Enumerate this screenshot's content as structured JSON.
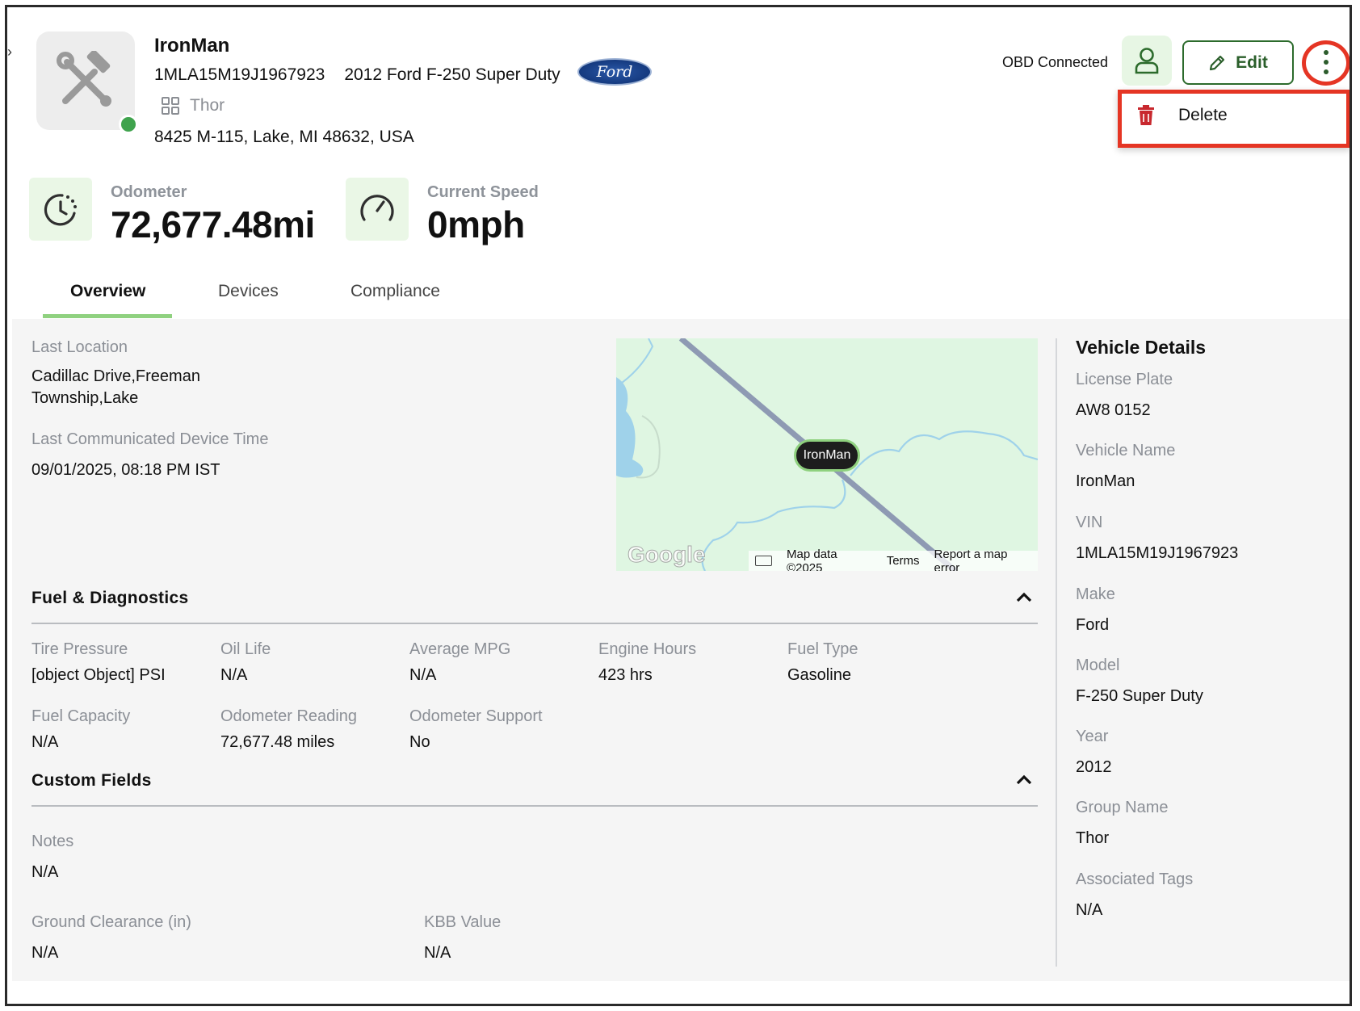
{
  "header": {
    "vehicle_name": "IronMan",
    "vin": "1MLA15M19J1967923",
    "description": "2012 Ford F-250 Super Duty",
    "make_logo": "Ford",
    "group": "Thor",
    "address": "8425 M-115, Lake, MI 48632, USA",
    "status_color": "#3fa34d"
  },
  "actions": {
    "obd_status": "OBD Connected",
    "edit_label": "Edit",
    "menu": {
      "delete_label": "Delete"
    }
  },
  "stats": {
    "odometer_label": "Odometer",
    "odometer_value": "72,677.48mi",
    "speed_label": "Current Speed",
    "speed_value": "0mph"
  },
  "tabs": [
    {
      "label": "Overview",
      "active": true
    },
    {
      "label": "Devices",
      "active": false
    },
    {
      "label": "Compliance",
      "active": false
    }
  ],
  "location": {
    "last_location_label": "Last Location",
    "last_location_line1": "Cadillac Drive,Freeman",
    "last_location_line2": "Township,Lake",
    "last_comm_label": "Last Communicated Device Time",
    "last_comm_value": "09/01/2025, 08:18 PM IST"
  },
  "map": {
    "pin_label": "IronMan",
    "google_logo": "Google",
    "map_data": "Map data ©2025",
    "terms": "Terms",
    "report": "Report a map error"
  },
  "fuel": {
    "title": "Fuel & Diagnostics",
    "fields": [
      {
        "label": "Tire Pressure",
        "value": "[object Object] PSI"
      },
      {
        "label": "Oil Life",
        "value": "N/A"
      },
      {
        "label": "Average MPG",
        "value": "N/A"
      },
      {
        "label": "Engine Hours",
        "value": "423 hrs"
      },
      {
        "label": "Fuel Type",
        "value": "Gasoline"
      },
      {
        "label": "Fuel Capacity",
        "value": "N/A"
      },
      {
        "label": "Odometer Reading",
        "value": "72,677.48 miles"
      },
      {
        "label": "Odometer Support",
        "value": "No"
      }
    ]
  },
  "custom": {
    "title": "Custom Fields",
    "fields": [
      {
        "label": "Notes",
        "value": "N/A"
      },
      {
        "label": "Ground Clearance (in)",
        "value": "N/A"
      },
      {
        "label": "KBB Value",
        "value": "N/A"
      }
    ]
  },
  "vehicle_details": {
    "title": "Vehicle Details",
    "fields": [
      {
        "label": "License Plate",
        "value": "AW8 0152"
      },
      {
        "label": "Vehicle Name",
        "value": "IronMan"
      },
      {
        "label": "VIN",
        "value": "1MLA15M19J1967923"
      },
      {
        "label": "Make",
        "value": "Ford"
      },
      {
        "label": "Model",
        "value": "F-250 Super Duty"
      },
      {
        "label": "Year",
        "value": "2012"
      },
      {
        "label": "Group Name",
        "value": "Thor"
      },
      {
        "label": "Associated Tags",
        "value": "N/A"
      }
    ]
  },
  "icons": {
    "avatar": "tools-icon",
    "group": "grid-icon",
    "person": "person-icon",
    "edit": "pencil-icon",
    "more": "more-vertical-icon",
    "delete": "trash-icon",
    "odometer": "odometer-icon",
    "speed": "speedometer-icon",
    "chevron": "chevron-up-icon"
  },
  "colors": {
    "accent_green": "#8fd17f",
    "dark_green": "#2c6b2c",
    "highlight_red": "#e53524",
    "delete_red": "#c8282e"
  }
}
